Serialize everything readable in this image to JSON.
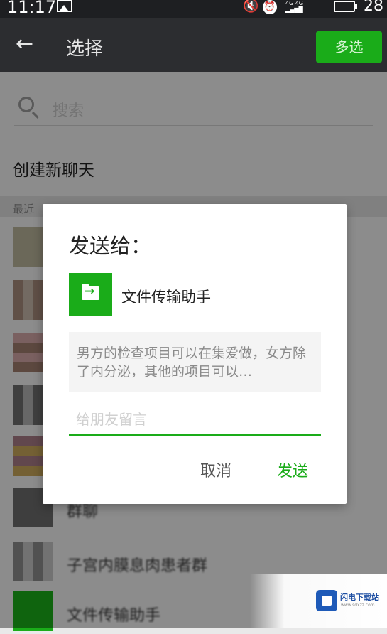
{
  "status_bar": {
    "time": "11:17",
    "battery_level": "28",
    "signal_text": "4G 4G"
  },
  "app_bar": {
    "title": "选择",
    "multi_select_label": "多选"
  },
  "search": {
    "placeholder": "搜索"
  },
  "new_chat_label": "创建新聊天",
  "recent_header": "最近",
  "contacts": [
    {
      "name": ""
    },
    {
      "name": ""
    },
    {
      "name": ""
    },
    {
      "name": ""
    },
    {
      "name": ""
    },
    {
      "name": "群聊"
    },
    {
      "name": "子宫内膜息肉患者群"
    },
    {
      "name": "文件传输助手"
    }
  ],
  "dialog": {
    "title": "发送给：",
    "recipient": "文件传输助手",
    "preview_text": "男方的检查项目可以在集爱做，女方除了内分泌，其他的项目可以…",
    "message_placeholder": "给朋友留言",
    "cancel_label": "取消",
    "send_label": "发送"
  },
  "watermark": {
    "title": "闪电下载站",
    "subtitle": "www.sdxzz.com"
  },
  "colors": {
    "accent_green": "#1aac19",
    "app_bar_bg": "#2c2d30",
    "status_bar_bg": "#1e1f22"
  }
}
